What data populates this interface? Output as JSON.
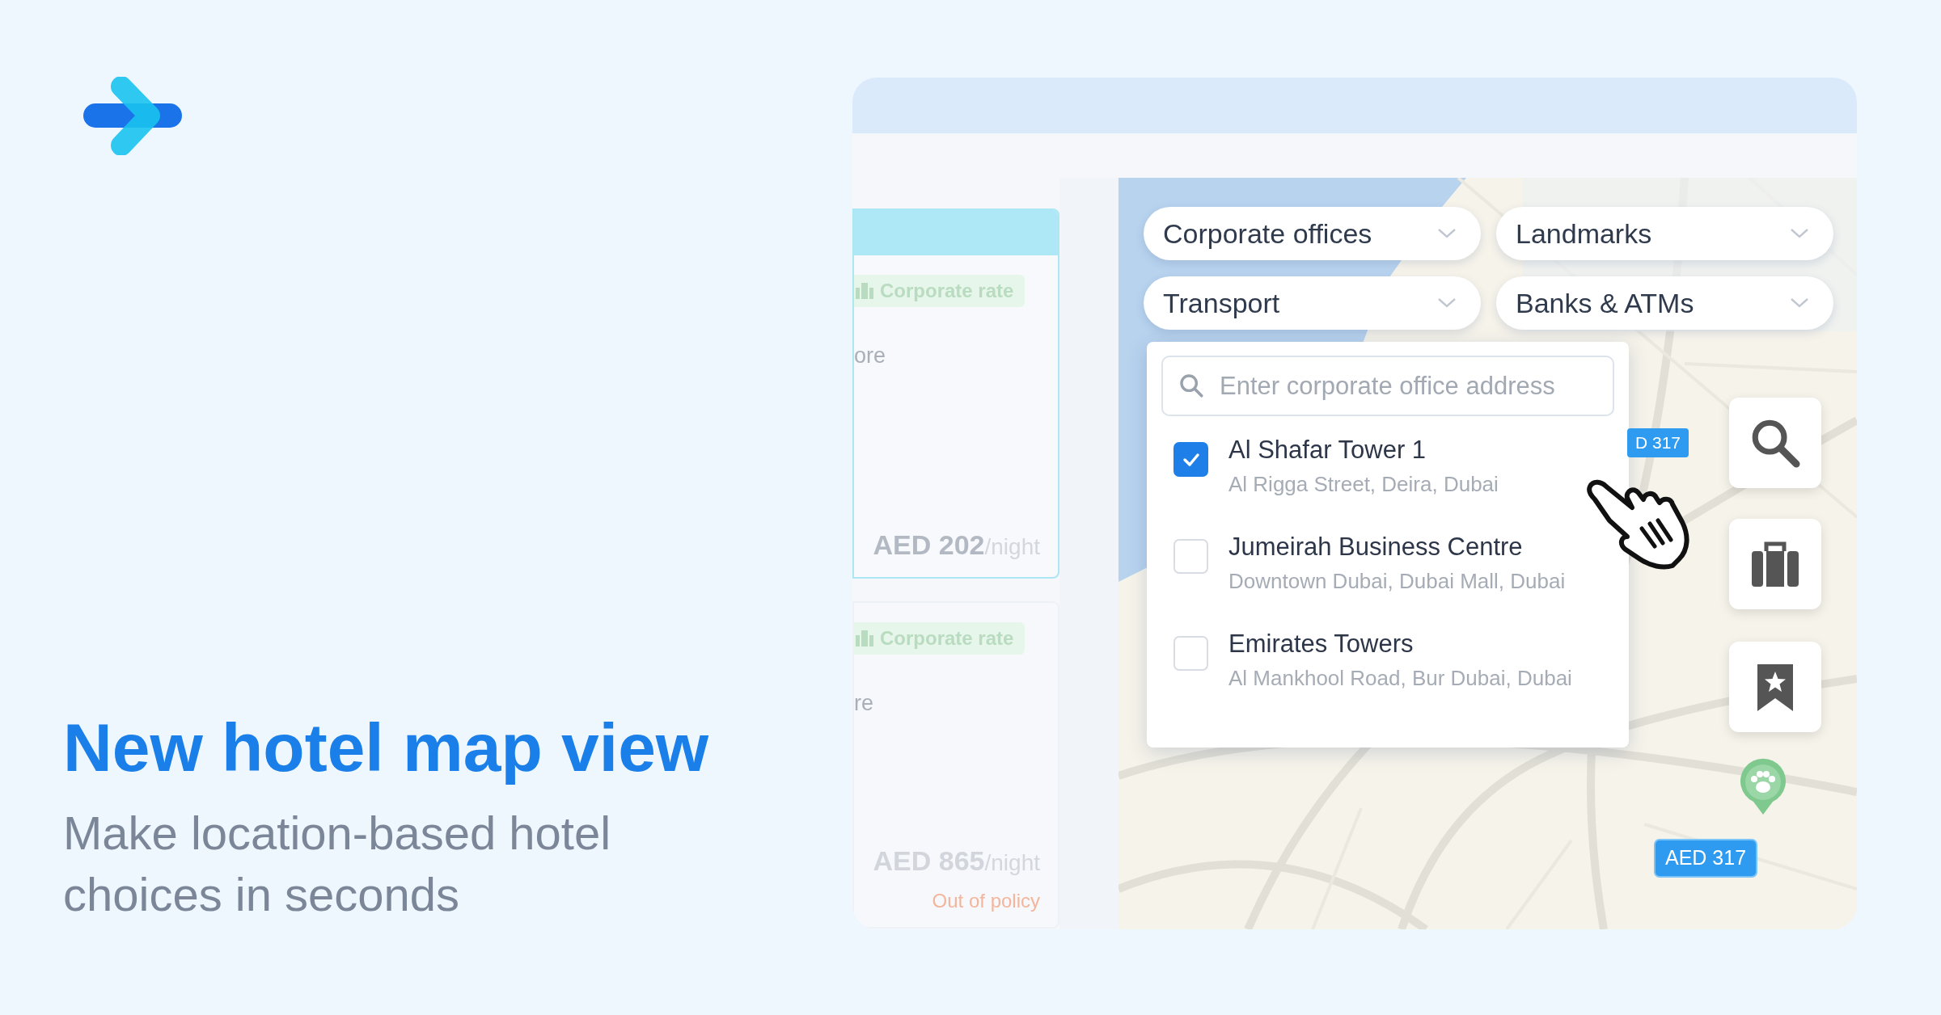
{
  "headline": "New hotel map view",
  "subtitle": "Make location-based hotel choices in seconds",
  "hotel_cards": [
    {
      "badge": "Corporate rate",
      "name_fragment": "ore",
      "price": "AED 202",
      "price_unit": "/night",
      "selected": true
    },
    {
      "badge": "Corporate rate",
      "name_fragment": "re",
      "price": "AED 865",
      "price_unit": "/night",
      "note": "Out of policy",
      "selected": false
    }
  ],
  "map": {
    "filters": [
      {
        "label": "Corporate offices"
      },
      {
        "label": "Landmarks"
      },
      {
        "label": "Transport"
      },
      {
        "label": "Banks & ATMs"
      }
    ],
    "office_search": {
      "placeholder": "Enter corporate office address"
    },
    "offices": [
      {
        "name": "Al Shafar Tower 1",
        "address": "Al Rigga Street, Deira, Dubai",
        "checked": true
      },
      {
        "name": "Jumeirah Business Centre",
        "address": "Downtown Dubai, Dubai Mall, Dubai",
        "checked": false
      },
      {
        "name": "Emirates Towers",
        "address": "Al Mankhool Road, Bur Dubai, Dubai",
        "checked": false
      }
    ],
    "price_pins": [
      "D 317",
      "AED 317"
    ]
  }
}
